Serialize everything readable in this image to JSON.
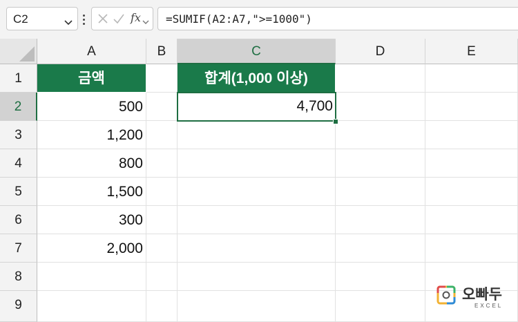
{
  "formula_bar": {
    "name_box": "C2",
    "formula": "=SUMIF(A2:A7,\">=1000\")"
  },
  "columns": [
    "A",
    "B",
    "C",
    "D",
    "E"
  ],
  "rows": [
    "1",
    "2",
    "3",
    "4",
    "5",
    "6",
    "7",
    "8",
    "9"
  ],
  "cells": {
    "A1": "금액",
    "A2": "500",
    "A3": "1,200",
    "A4": "800",
    "A5": "1,500",
    "A6": "300",
    "A7": "2,000",
    "C1": "합계(1,000 이상)",
    "C2": "4,700"
  },
  "watermark": {
    "brand": "오빠두",
    "sub": "EXCEL"
  },
  "colors": {
    "header_fill": "#1a7a4a",
    "selection": "#1e6e42"
  }
}
